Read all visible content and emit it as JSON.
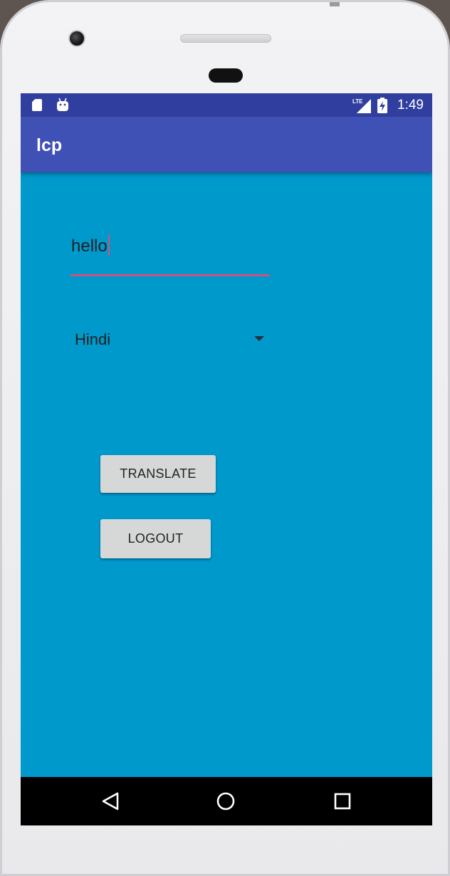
{
  "status_bar": {
    "time": "1:49",
    "network": "LTE",
    "icons": [
      "sd-card-icon",
      "android-icon",
      "lte-signal-icon",
      "battery-charging-icon"
    ]
  },
  "app_bar": {
    "title": "lcp"
  },
  "form": {
    "text_input_value": "hello",
    "language_selected": "Hindi"
  },
  "buttons": {
    "translate_label": "TRANSLATE",
    "logout_label": "LOGOUT"
  },
  "nav_bar": {
    "icons": [
      "back-icon",
      "home-icon",
      "recents-icon"
    ]
  },
  "colors": {
    "status_bar": "#303f9f",
    "app_bar": "#3f51b5",
    "background": "#0099cc",
    "accent": "#d0527f",
    "button": "#d6d7d7"
  }
}
